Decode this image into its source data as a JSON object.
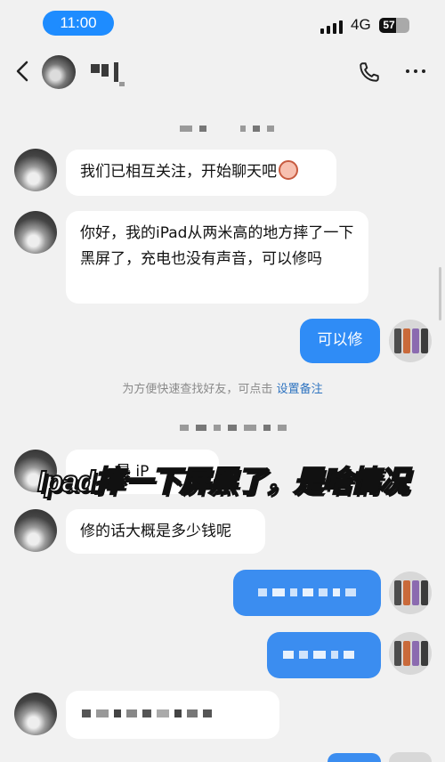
{
  "status_bar": {
    "time": "11:00",
    "network": "4G",
    "battery": "57",
    "battery_level": 0.57
  },
  "nav": {
    "back_icon": "chevron-left-icon",
    "call_icon": "phone-icon",
    "more_icon": "more-icon"
  },
  "messages": {
    "m1": "我们已相互关注，开始聊天吧",
    "m2": "你好，我的iPad从两米高的地方摔了一下黑屏了，充电也没有声音，可以修吗",
    "m3": "可以修",
    "m4_partial": "是 iP",
    "m5": "修的话大概是多少钱呢"
  },
  "system_note": {
    "text": "为方便快速查找好友，可点击 ",
    "link": "设置备注"
  },
  "caption": "Ipad摔一下屏黑了，是啥情况",
  "colors": {
    "accent": "#2f8cf6",
    "background": "#f1f1f1",
    "link": "#2f74c0"
  }
}
